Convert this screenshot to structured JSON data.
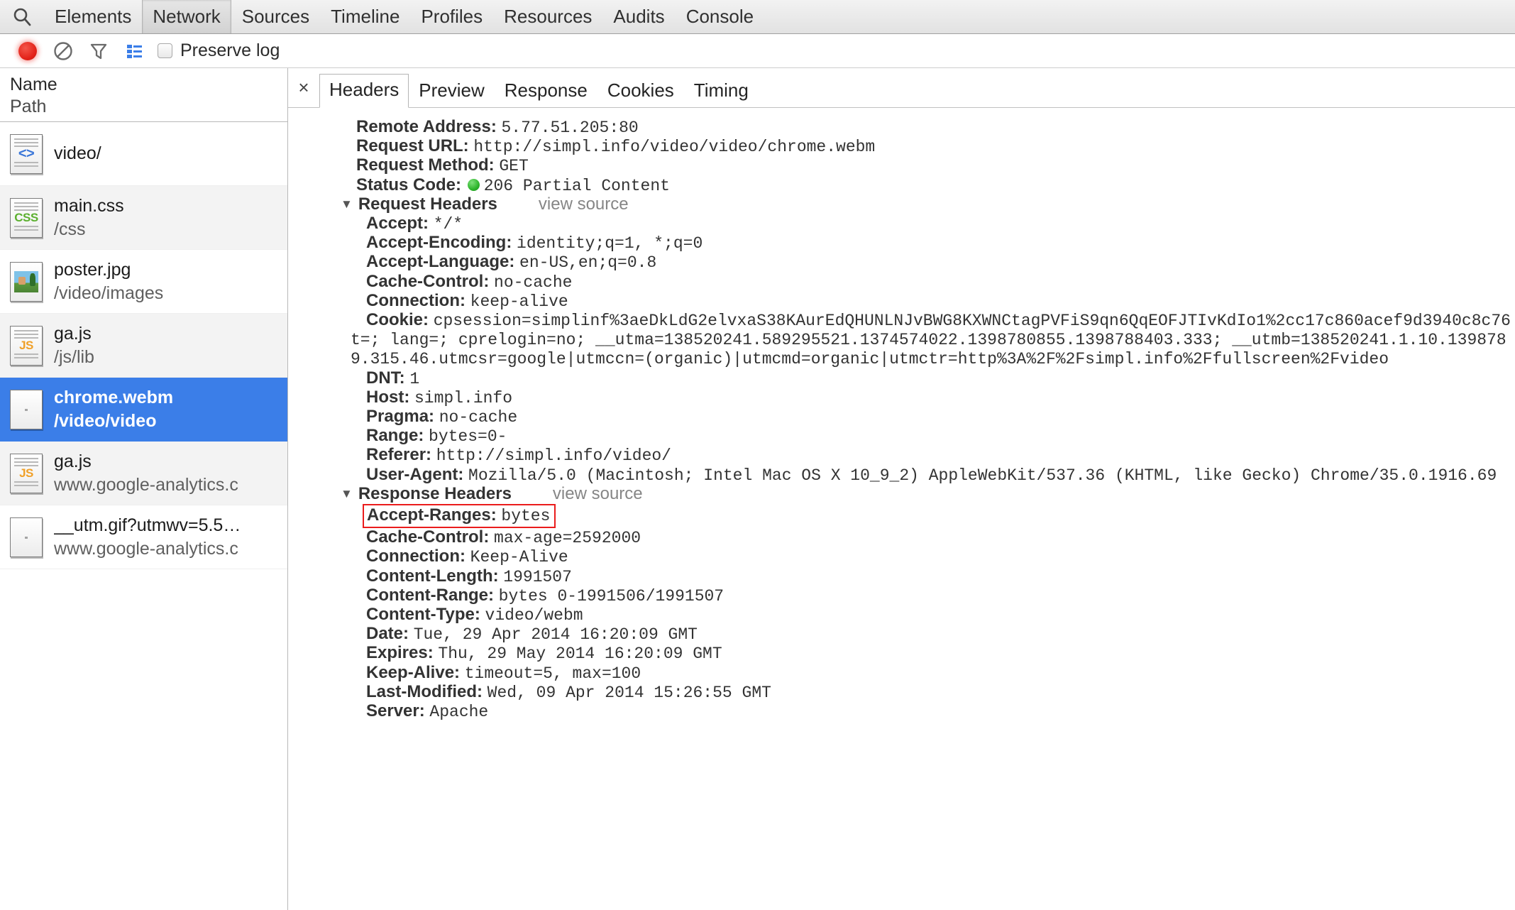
{
  "main_tabs": [
    {
      "label": "Elements",
      "selected": false
    },
    {
      "label": "Network",
      "selected": true
    },
    {
      "label": "Sources",
      "selected": false
    },
    {
      "label": "Timeline",
      "selected": false
    },
    {
      "label": "Profiles",
      "selected": false
    },
    {
      "label": "Resources",
      "selected": false
    },
    {
      "label": "Audits",
      "selected": false
    },
    {
      "label": "Console",
      "selected": false
    }
  ],
  "toolbar": {
    "record_icon": "record-dot-icon",
    "clear_icon": "clear-prohibited-icon",
    "filter_icon": "filter-funnel-icon",
    "grouping_icon": "list-grouping-icon",
    "preserve_log_label": "Preserve log",
    "preserve_log_checked": false
  },
  "request_list": {
    "header": {
      "name": "Name",
      "path": "Path"
    },
    "rows": [
      {
        "name": "video/",
        "path": "",
        "icon": "html-document-icon",
        "selected": false
      },
      {
        "name": "main.css",
        "path": "/css",
        "icon": "css-document-icon",
        "selected": false
      },
      {
        "name": "poster.jpg",
        "path": "/video/images",
        "icon": "image-thumbnail-icon",
        "selected": false
      },
      {
        "name": "ga.js",
        "path": "/js/lib",
        "icon": "js-document-icon",
        "selected": false
      },
      {
        "name": "chrome.webm",
        "path": "/video/video",
        "icon": "blank-document-icon",
        "selected": true
      },
      {
        "name": "ga.js",
        "path": "www.google-analytics.c",
        "icon": "js-document-icon",
        "selected": false
      },
      {
        "name": "__utm.gif?utmwv=5.5…",
        "path": "www.google-analytics.c",
        "icon": "blank-document-icon",
        "selected": false
      }
    ]
  },
  "detail": {
    "close_label": "×",
    "tabs": [
      {
        "label": "Headers",
        "selected": true
      },
      {
        "label": "Preview",
        "selected": false
      },
      {
        "label": "Response",
        "selected": false
      },
      {
        "label": "Cookies",
        "selected": false
      },
      {
        "label": "Timing",
        "selected": false
      }
    ],
    "general": [
      {
        "key": "Remote Address:",
        "value": "5.77.51.205:80"
      },
      {
        "key": "Request URL:",
        "value": "http://simpl.info/video/video/chrome.webm"
      },
      {
        "key": "Request Method:",
        "value": "GET"
      }
    ],
    "status": {
      "key": "Status Code:",
      "value": "206 Partial Content",
      "dot_color": "#30b62e"
    },
    "request_headers": {
      "title": "Request Headers",
      "view_source": "view source",
      "expanded": true,
      "items": [
        {
          "key": "Accept:",
          "value": "*/*"
        },
        {
          "key": "Accept-Encoding:",
          "value": "identity;q=1, *;q=0"
        },
        {
          "key": "Accept-Language:",
          "value": "en-US,en;q=0.8"
        },
        {
          "key": "Cache-Control:",
          "value": "no-cache"
        },
        {
          "key": "Connection:",
          "value": "keep-alive"
        }
      ],
      "cookie": {
        "key": "Cookie:",
        "line1": "cpsession=simplinf%3aeDkLdG2elvxaS38KAurEdQHUNLNJvBWG8KXWNCtagPVFiS9qn6QqEOFJTIvKdIo1%2cc17c860acef9d3940c8c76",
        "line2": "t=; lang=; cprelogin=no;  __utma=138520241.589295521.1374574022.1398780855.1398788403.333;  __utmb=138520241.1.10.139878",
        "line3": "9.315.46.utmcsr=google|utmccn=(organic)|utmcmd=organic|utmctr=http%3A%2F%2Fsimpl.info%2Ffullscreen%2Fvideo"
      },
      "items_after": [
        {
          "key": "DNT:",
          "value": "1"
        },
        {
          "key": "Host:",
          "value": "simpl.info"
        },
        {
          "key": "Pragma:",
          "value": "no-cache"
        },
        {
          "key": "Range:",
          "value": "bytes=0-"
        },
        {
          "key": "Referer:",
          "value": "http://simpl.info/video/"
        },
        {
          "key": "User-Agent:",
          "value": "Mozilla/5.0 (Macintosh; Intel Mac OS X 10_9_2) AppleWebKit/537.36 (KHTML, like Gecko) Chrome/35.0.1916.69"
        }
      ]
    },
    "response_headers": {
      "title": "Response Headers",
      "view_source": "view source",
      "expanded": true,
      "highlighted": {
        "key": "Accept-Ranges:",
        "value": "bytes",
        "highlight_color": "#ea1c1c"
      },
      "items": [
        {
          "key": "Cache-Control:",
          "value": "max-age=2592000"
        },
        {
          "key": "Connection:",
          "value": "Keep-Alive"
        },
        {
          "key": "Content-Length:",
          "value": "1991507"
        },
        {
          "key": "Content-Range:",
          "value": "bytes 0-1991506/1991507"
        },
        {
          "key": "Content-Type:",
          "value": "video/webm"
        },
        {
          "key": "Date:",
          "value": "Tue, 29 Apr 2014 16:20:09 GMT"
        },
        {
          "key": "Expires:",
          "value": "Thu, 29 May 2014 16:20:09 GMT"
        },
        {
          "key": "Keep-Alive:",
          "value": "timeout=5, max=100"
        },
        {
          "key": "Last-Modified:",
          "value": "Wed, 09 Apr 2014 15:26:55 GMT"
        },
        {
          "key": "Server:",
          "value": "Apache"
        }
      ]
    }
  },
  "colors": {
    "selection_blue": "#3b7ee8",
    "highlight_red": "#ea1c1c",
    "status_green": "#30b62e"
  }
}
